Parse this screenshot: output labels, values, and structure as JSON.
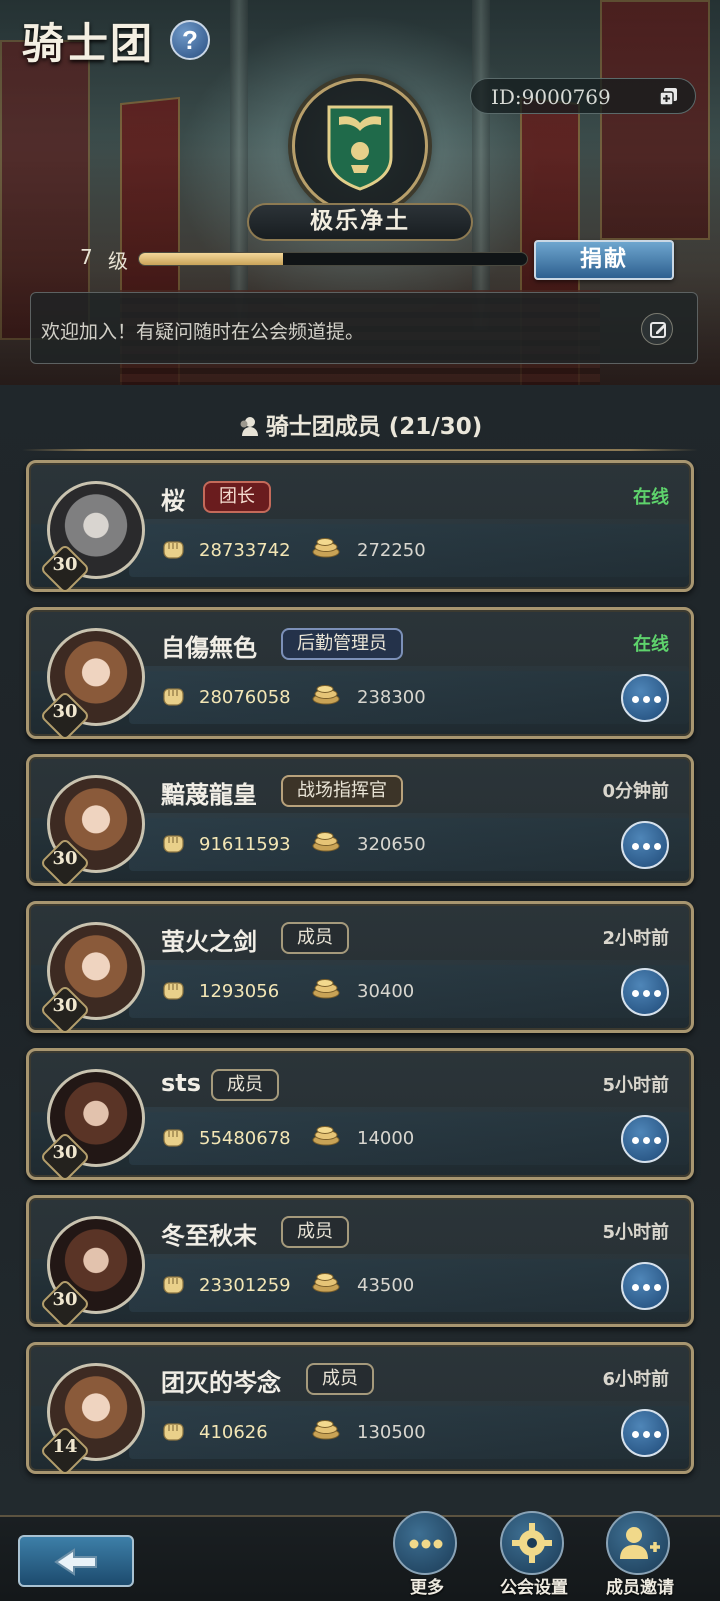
{
  "header": {
    "title": "骑士团",
    "help_icon": "?",
    "id_text": "ID:9000769",
    "guild_name": "极乐净土",
    "level_number": "7",
    "level_unit": "级",
    "level_progress": 0.37,
    "donate_label": "捐献",
    "notice": "欢迎加入！有疑问随时在公会频道提。"
  },
  "members": {
    "title": "骑士团成员 (21/30)",
    "list": [
      {
        "name": "桜",
        "role": "团长",
        "role_style": "leader",
        "status": "在线",
        "online": true,
        "level": "30",
        "power": "28733742",
        "contribution": "272250",
        "avatar": "a-grey",
        "show_more": false
      },
      {
        "name": "自傷無色",
        "role": "后勤管理员",
        "role_style": "logistics",
        "status": "在线",
        "online": true,
        "level": "30",
        "power": "28076058",
        "contribution": "238300",
        "avatar": "a-light",
        "show_more": true
      },
      {
        "name": "黯蔑龍皇",
        "role": "战场指挥官",
        "role_style": "commander",
        "status": "0分钟前",
        "online": false,
        "level": "30",
        "power": "91611593",
        "contribution": "320650",
        "avatar": "a-light",
        "show_more": true
      },
      {
        "name": "萤火之剑",
        "role": "成员",
        "role_style": "member",
        "status": "2小时前",
        "online": false,
        "level": "30",
        "power": "1293056",
        "contribution": "30400",
        "avatar": "a-light",
        "show_more": true
      },
      {
        "name": "sts",
        "role": "成员",
        "role_style": "member",
        "status": "5小时前",
        "online": false,
        "level": "30",
        "power": "55480678",
        "contribution": "14000",
        "avatar": "a-dark",
        "show_more": true
      },
      {
        "name": "冬至秋末",
        "role": "成员",
        "role_style": "member",
        "status": "5小时前",
        "online": false,
        "level": "30",
        "power": "23301259",
        "contribution": "43500",
        "avatar": "a-dark",
        "show_more": true
      },
      {
        "name": "团灭的岑念",
        "role": "成员",
        "role_style": "member",
        "status": "6小时前",
        "online": false,
        "level": "14",
        "power": "410626",
        "contribution": "130500",
        "avatar": "a-light",
        "show_more": true
      }
    ]
  },
  "bottom_bar": {
    "more_label": "更多",
    "settings_label": "公会设置",
    "invite_label": "成员邀请"
  },
  "colors": {
    "online": "#5ed36c",
    "accent_gold": "#a89670",
    "button_blue": "#2e5f8f"
  },
  "icons": {
    "help": "help-icon",
    "copy": "copy-icon",
    "edit": "edit-icon",
    "power": "fist-icon",
    "contribution": "coin-stack-icon",
    "more": "ellipsis-icon",
    "back": "back-arrow-icon",
    "settings": "gear-icon",
    "invite": "add-person-icon"
  }
}
